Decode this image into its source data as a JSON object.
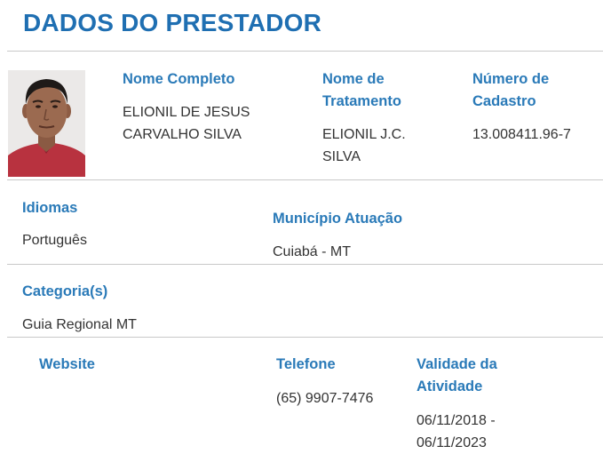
{
  "page": {
    "title": "DADOS DO PRESTADOR"
  },
  "profile": {
    "full_name_label": "Nome Completo",
    "full_name_line1": "ELIONIL DE JESUS",
    "full_name_line2": "CARVALHO SILVA",
    "treatment_label_line1": "Nome de",
    "treatment_label_line2": "Tratamento",
    "treatment_line1": "ELIONIL J.C.",
    "treatment_line2": "SILVA",
    "registration_label_line1": "Número de",
    "registration_label_line2": "Cadastro",
    "registration_number": "13.008411.96-7"
  },
  "languages": {
    "label": "Idiomas",
    "value": "Português"
  },
  "municipality": {
    "label": "Município Atuação",
    "value": "Cuiabá - MT"
  },
  "categories": {
    "label": "Categoria(s)",
    "value": "Guia Regional MT"
  },
  "contact": {
    "website_label": "Website",
    "phone_label": "Telefone",
    "phone": "(65) 9907-7476",
    "validity_label_line1": "Validade da",
    "validity_label_line2": "Atividade",
    "validity_line1": "06/11/2018 -",
    "validity_line2": "06/11/2023"
  },
  "colors": {
    "heading": "#1f6fb2",
    "label": "#2a7ab8",
    "text": "#333333",
    "rule": "#c8c8c8"
  }
}
